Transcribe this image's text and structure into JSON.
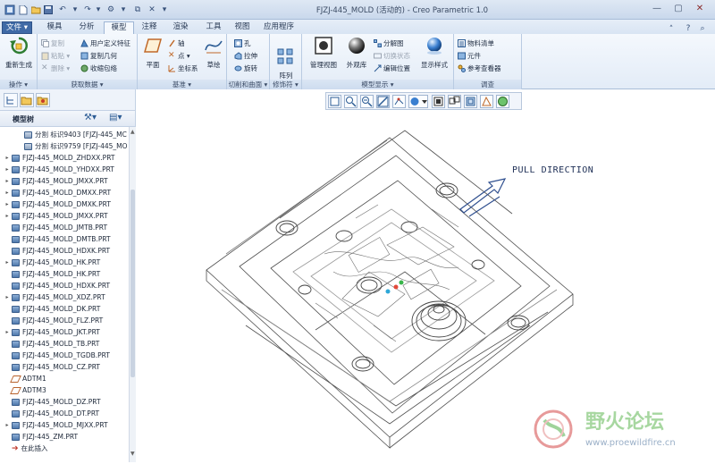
{
  "app": {
    "title": "FJZJ-445_MOLD (活动的) - Creo Parametric 1.0"
  },
  "tabs": [
    "文件 ▾",
    "模具",
    "分析",
    "模型",
    "注释",
    "渲染",
    "工具",
    "视图",
    "应用程序"
  ],
  "ribbon": {
    "ops": {
      "regen": "重新生成",
      "label": "操作 ▾"
    },
    "data": {
      "copy": "复制",
      "paste": "粘贴 ▾",
      "delete": "删除 ▾",
      "udf": "用户定义特征",
      "copy_geom": "复制几何",
      "shrink": "收缩包络",
      "label": "获取数据 ▾"
    },
    "datum": {
      "plane": "平面",
      "axis": "轴",
      "point": "点 ▾",
      "csys": "坐标系",
      "sketch": "草绘",
      "label": "基准 ▾"
    },
    "cut": {
      "hole": "孔",
      "stretch": "拉伸",
      "rotate": "旋转",
      "label": "切削和曲面 ▾"
    },
    "mod": {
      "array": "阵列",
      "label": "修饰符 ▾"
    },
    "display": {
      "manage": "管理视图",
      "appearance": "外观库",
      "explode": "分解图",
      "toggle": "切换状态",
      "edit_pos": "编辑位置",
      "style": "显示样式",
      "label": "模型显示 ▾"
    },
    "survey": {
      "bom": "物料清单",
      "component": "元件",
      "ref": "参考查看器",
      "label": "调查"
    }
  },
  "tree": {
    "title": "模型树",
    "items": [
      {
        "t": "分割 标识9403 [FJZJ-445_MC",
        "k": "cut"
      },
      {
        "t": "分割 标识9759 [FJZJ-445_MO",
        "k": "cut"
      },
      {
        "t": "FJZJ-445_MOLD_ZHDXX.PRT",
        "k": "part",
        "e": true
      },
      {
        "t": "FJZJ-445_MOLD_YHDXX.PRT",
        "k": "part",
        "e": true
      },
      {
        "t": "FJZJ-445_MOLD_JMXX.PRT",
        "k": "part",
        "e": true
      },
      {
        "t": "FJZJ-445_MOLD_DMXX.PRT",
        "k": "part",
        "e": true
      },
      {
        "t": "FJZJ-445_MOLD_DMXK.PRT",
        "k": "part",
        "e": true
      },
      {
        "t": "FJZJ-445_MOLD_JMXX.PRT",
        "k": "part",
        "e": true
      },
      {
        "t": "FJZJ-445_MOLD_JMTB.PRT",
        "k": "part"
      },
      {
        "t": "FJZJ-445_MOLD_DMTB.PRT",
        "k": "part"
      },
      {
        "t": "FJZJ-445_MOLD_HDXK.PRT",
        "k": "part"
      },
      {
        "t": "FJZJ-445_MOLD_HK.PRT",
        "k": "part",
        "e": true
      },
      {
        "t": "FJZJ-445_MOLD_HK.PRT",
        "k": "part"
      },
      {
        "t": "FJZJ-445_MOLD_HDXK.PRT",
        "k": "part"
      },
      {
        "t": "FJZJ-445_MOLD_XDZ.PRT",
        "k": "part",
        "e": true
      },
      {
        "t": "FJZJ-445_MOLD_DK.PRT",
        "k": "part"
      },
      {
        "t": "FJZJ-445_MOLD_FLZ.PRT",
        "k": "part"
      },
      {
        "t": "FJZJ-445_MOLD_JKT.PRT",
        "k": "part",
        "e": true
      },
      {
        "t": "FJZJ-445_MOLD_TB.PRT",
        "k": "part"
      },
      {
        "t": "FJZJ-445_MOLD_TGDB.PRT",
        "k": "part"
      },
      {
        "t": "FJZJ-445_MOLD_CZ.PRT",
        "k": "part"
      },
      {
        "t": "ADTM1",
        "k": "datum"
      },
      {
        "t": "ADTM3",
        "k": "datum"
      },
      {
        "t": "FJZJ-445_MOLD_DZ.PRT",
        "k": "part"
      },
      {
        "t": "FJZJ-445_MOLD_DT.PRT",
        "k": "part"
      },
      {
        "t": "FJZJ-445_MOLD_MJXX.PRT",
        "k": "part",
        "e": true
      },
      {
        "t": "FJZJ-445_ZM.PRT",
        "k": "part"
      },
      {
        "t": "在此插入",
        "k": "insert"
      }
    ]
  },
  "canvas": {
    "pull": "PULL DIRECTION"
  },
  "watermark": {
    "name": "野火论坛",
    "url": "www.proewildfire.cn"
  },
  "colors": {
    "accent": "#2f5a97",
    "mold_line": "#4a4a4a",
    "tree_icon": "#4f79ad"
  }
}
